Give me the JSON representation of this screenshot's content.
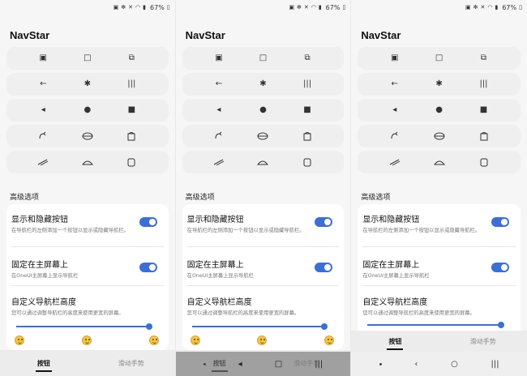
{
  "status": {
    "battery": "67%"
  },
  "app_title": "NavStar",
  "style_rows": [
    [
      "▣",
      "□",
      "⧉"
    ],
    [
      "←",
      "✱",
      "|||"
    ],
    [
      "◂",
      "●",
      "■"
    ],
    [
      "stylized-1",
      "stylized-2",
      "stylized-3"
    ],
    [
      "stylized-4",
      "stylized-5",
      "stylized-6"
    ]
  ],
  "section_header": "高级选项",
  "settings": {
    "show_hide_title": "显示和隐藏按钮",
    "show_hide_desc": "在导航栏的左侧添加一个按钮以显示或隐藏导航栏。",
    "home_title": "固定在主屏幕上",
    "home_desc": "在OneUI主屏幕上显示导航栏",
    "height_title": "自定义导航栏高度",
    "height_desc": "您可以通过调整导航栏的高度来使用更宽的屏幕。"
  },
  "slider": {
    "value": 1.0
  },
  "tabs": {
    "buttons": "按钮",
    "gestures": "滑动手势"
  },
  "colors": {
    "accent": "#3b6fd8"
  }
}
